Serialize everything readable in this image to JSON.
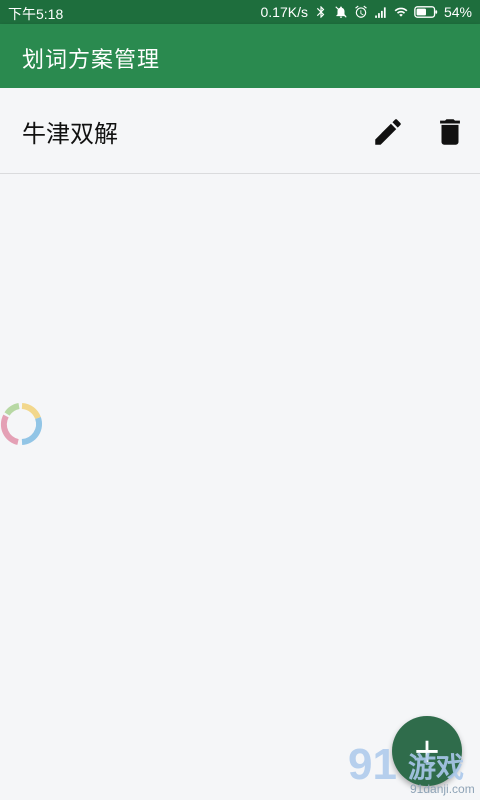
{
  "status_bar": {
    "time": "下午5:18",
    "network_speed": "0.17K/s",
    "battery": "54%",
    "icons": [
      "bluetooth-icon",
      "mute-icon",
      "alarm-icon",
      "signal-icon",
      "wifi-icon",
      "battery-icon"
    ]
  },
  "app_bar": {
    "title": "划词方案管理",
    "color": "#2a8a4f"
  },
  "list": {
    "items": [
      {
        "label": "牛津双解",
        "actions": [
          "edit-icon",
          "delete-icon"
        ]
      }
    ]
  },
  "fab": {
    "label": "+",
    "color": "#2f6c4b"
  },
  "watermark": {
    "brand_number": "91",
    "brand_text": "游戏",
    "url": "91danji.com"
  }
}
